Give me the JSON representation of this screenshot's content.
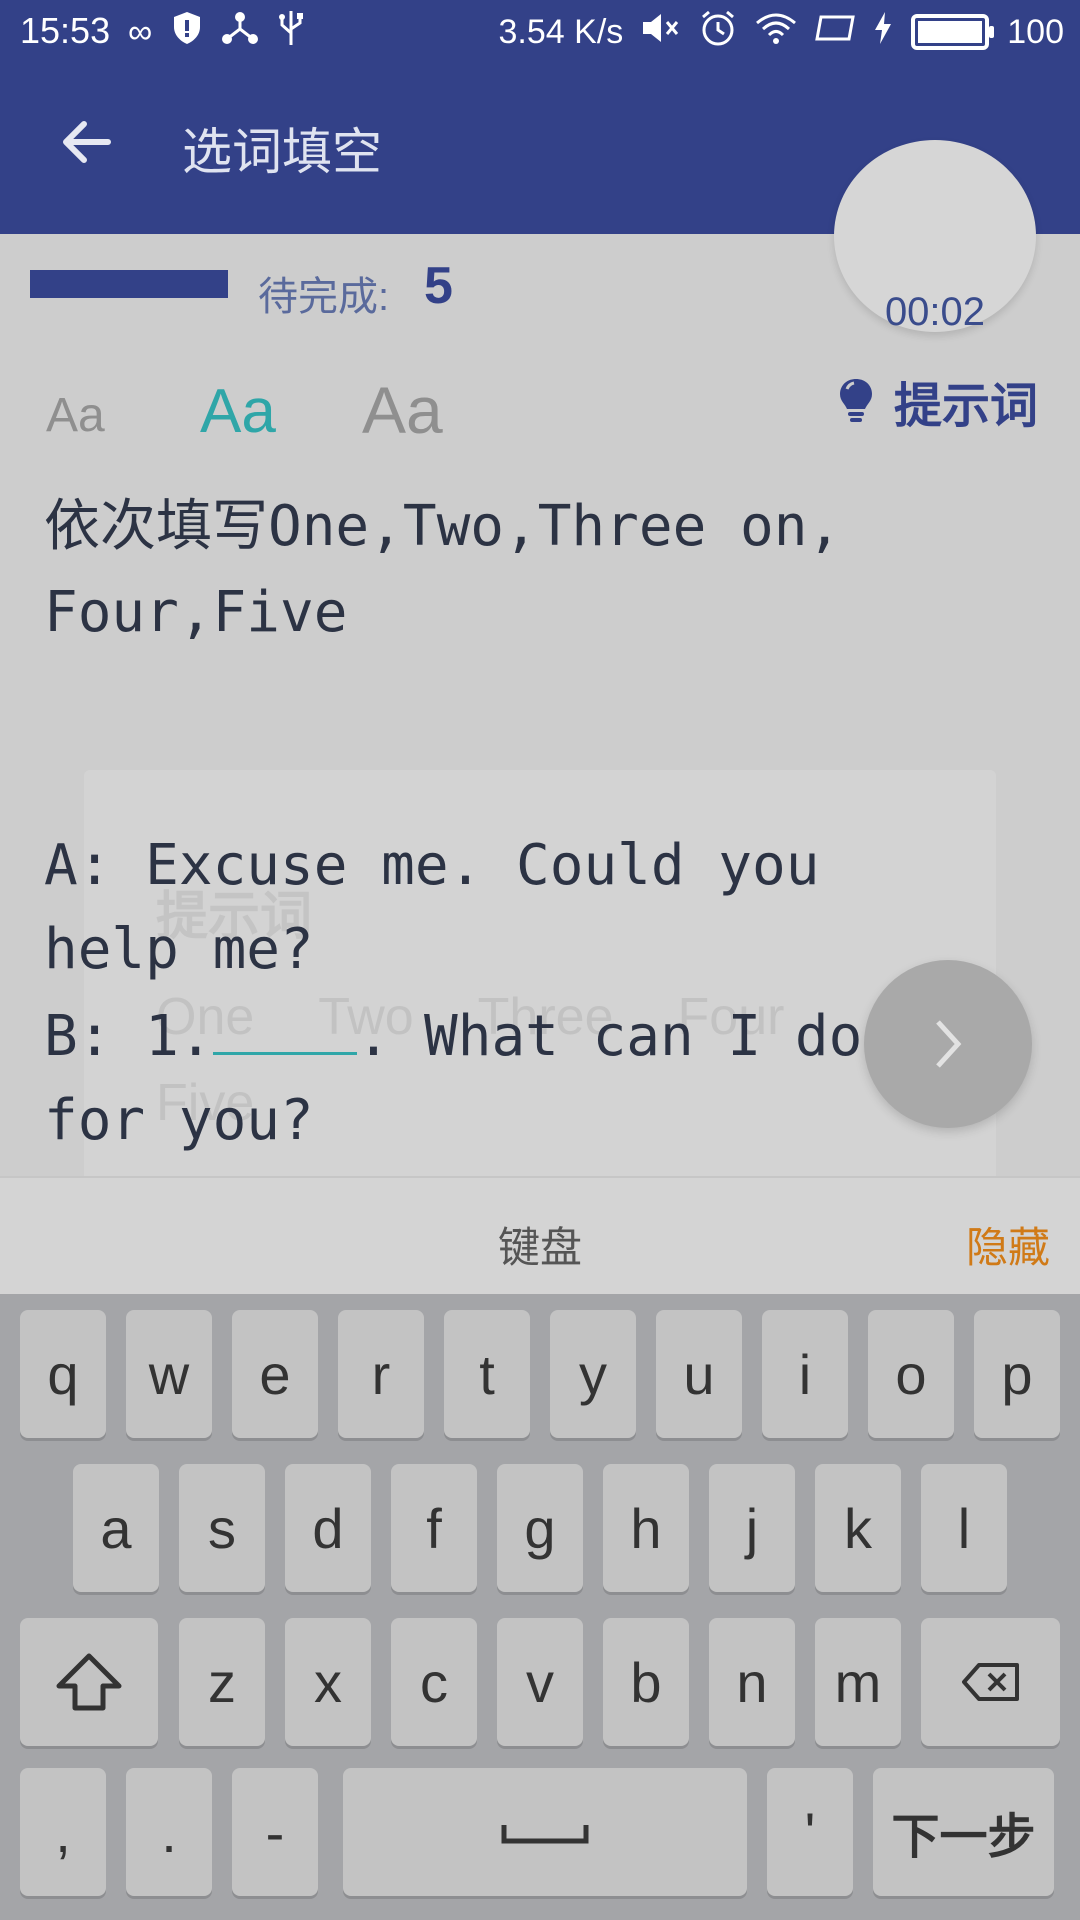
{
  "status_bar": {
    "time": "15:53",
    "speed": "3.54 K/s",
    "battery_level": "100"
  },
  "app_bar": {
    "title": "选词填空"
  },
  "progress": {
    "pending_label": "待完成:",
    "pending_count": "5",
    "timer": "00:02"
  },
  "font_sizes": [
    "Aa",
    "Aa",
    "Aa"
  ],
  "hint": {
    "button_label": "提示词",
    "panel_title": "提示词",
    "words": [
      "One",
      "Two",
      "Three",
      "Four",
      "Five"
    ]
  },
  "question": {
    "instruction_line1": "依次填写One,Two,Three on,",
    "instruction_line2": "Four,Five",
    "line_a1": "A: Excuse me. Could you",
    "line_a2": "help me?",
    "line_b_prefix": "B: 1.",
    "line_b_suffix": ". What can I do",
    "line_b2": "for you?"
  },
  "keyboard": {
    "title": "键盘",
    "hide_label": "隐藏",
    "row1": [
      "q",
      "w",
      "e",
      "r",
      "t",
      "y",
      "u",
      "i",
      "o",
      "p"
    ],
    "row2": [
      "a",
      "s",
      "d",
      "f",
      "g",
      "h",
      "j",
      "k",
      "l"
    ],
    "row3": [
      "z",
      "x",
      "c",
      "v",
      "b",
      "n",
      "m"
    ],
    "comma": ",",
    "period": ".",
    "dash": "-",
    "apostrophe": "'",
    "next_label": "下一步"
  },
  "colors": {
    "primary": "#334188",
    "accent": "#2fa6a8",
    "hide": "#d07a17"
  }
}
